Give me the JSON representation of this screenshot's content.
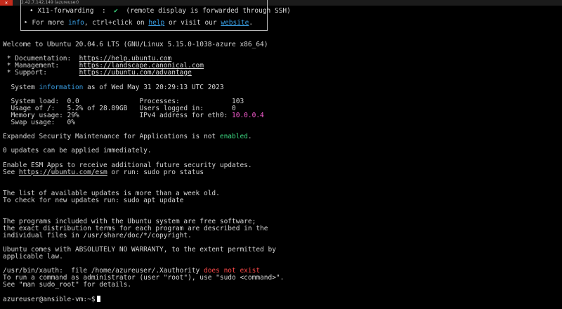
{
  "window": {
    "tab_title": "2.42.7.142.149 (azureuser)"
  },
  "banner": {
    "x11_label": "X11-forwarding",
    "x11_sep": ":",
    "x11_check": "✔",
    "x11_desc": "(remote display is forwarded through SSH)",
    "more_pre": "For more ",
    "more_info": "info",
    "more_mid": ", ctrl+click on ",
    "more_help": "help",
    "more_mid2": " or visit our ",
    "more_website": "website",
    "more_end": "."
  },
  "terminal": {
    "welcome": "Welcome to Ubuntu 20.04.6 LTS (GNU/Linux 5.15.0-1038-azure x86_64)",
    "doc_label": " * Documentation:  ",
    "doc_url": "https://help.ubuntu.com",
    "mgmt_label": " * Management:     ",
    "mgmt_url": "https://landscape.canonical.com",
    "support_label": " * Support:        ",
    "support_url": "https://ubuntu.com/advantage",
    "sysinfo_pre": "  System ",
    "sysinfo_word": "information",
    "sysinfo_post": " as of Wed May 31 20:29:13 UTC 2023",
    "stat1": "  System load:  0.0               Processes:             103",
    "stat2": "  Usage of /:   5.2% of 28.89GB   Users logged in:       0",
    "stat3_pre": "  Memory usage: 29%               IPv4 address for eth0: ",
    "stat3_ip": "10.0.0.4",
    "stat4": "  Swap usage:   0%",
    "esm_pre": "Expanded Security Maintenance for Applications is not ",
    "esm_word": "enabled",
    "esm_end": ".",
    "updates": "0 updates can be applied immediately.",
    "esm_apps": "Enable ESM Apps to receive additional future security updates.",
    "see_pre": "See ",
    "see_url": "https://ubuntu.com/esm",
    "see_post": " or run: sudo pro status",
    "list_old": "The list of available updates is more than a week old.",
    "check_updates": "To check for new updates run: sudo apt update",
    "free1": "The programs included with the Ubuntu system are free software;",
    "free2": "the exact distribution terms for each program are described in the",
    "free3": "individual files in /usr/share/doc/*/copyright.",
    "warranty1": "Ubuntu comes with ABSOLUTELY NO WARRANTY, to the extent permitted by",
    "warranty2": "applicable law.",
    "xauth_pre": "/usr/bin/xauth:  file /home/azureuser/.Xauthority ",
    "xauth_err": "does not exist",
    "sudo1": "To run a command as administrator (user \"root\"), use \"sudo <command>\".",
    "sudo2": "See \"man sudo_root\" for details.",
    "prompt": "azureuser@ansible-vm:~$"
  }
}
